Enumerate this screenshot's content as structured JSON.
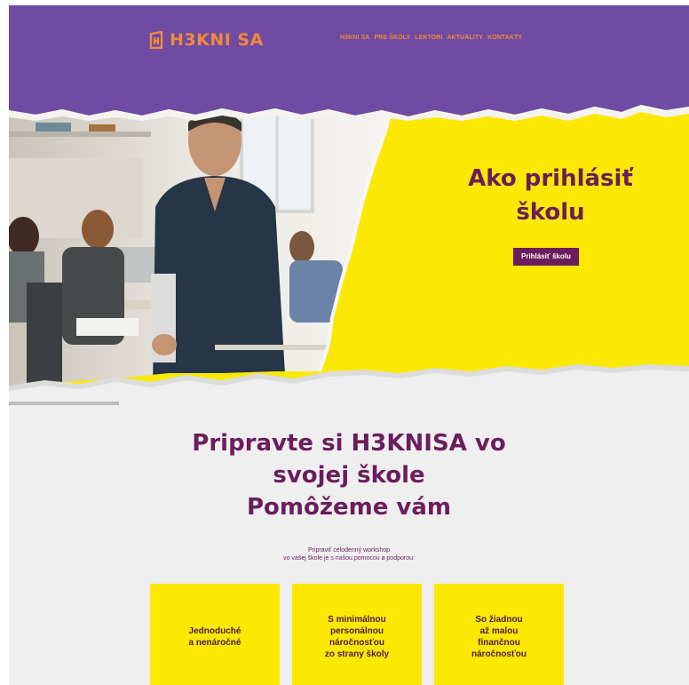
{
  "header": {
    "logo_text": "H3KNI SA",
    "nav": [
      "H3KNI SA",
      "PRE ŠKOLY",
      "LEKTORI",
      "AKTUALITY",
      "KONTAKTY"
    ]
  },
  "hero": {
    "title_line1": "Ako prihlásiť",
    "title_line2": "školu",
    "cta_label": "Prihlásiť školu"
  },
  "section": {
    "title_line1": "Pripravte si H3KNISA vo",
    "title_line2": "svojej škole",
    "title_line3": "Pomôžeme vám",
    "subtitle_line1": "Pripraviť celodenný workshop",
    "subtitle_line2": "vo vašej škole je s našou pomocou a podporou:"
  },
  "cards": [
    "Jednoduché\na nenáročné",
    "S minimálnou\npersonálnou\nnáročnosťou\nzo strany školy",
    "So žiadnou\naž malou\nfinančnou\nnáročnosťou"
  ],
  "colors": {
    "header_bg": "#6f4ba3",
    "accent_orange": "#f08a3a",
    "yellow": "#fde802",
    "plum": "#6b1d5c",
    "paper": "#efefef"
  },
  "icons": {
    "logo": "logo-mark-icon"
  }
}
